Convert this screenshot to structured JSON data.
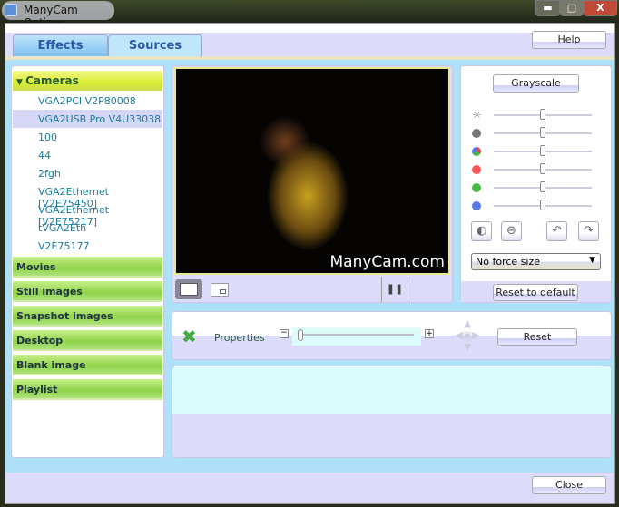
{
  "window": {
    "title": "ManyCam Options",
    "controls": [
      "minimize",
      "maximize",
      "close"
    ]
  },
  "tabs": [
    {
      "label": "Effects",
      "active": false
    },
    {
      "label": "Sources",
      "active": true
    }
  ],
  "help_label": "Help",
  "sources": {
    "cameras_label": "Cameras",
    "cameras": [
      "VGA2PCI V2P80008",
      "VGA2USB Pro V4U33038",
      "100",
      "44",
      "2fgh",
      "VGA2Ethernet [V2E75450]",
      "VGA2Ethernet [V2E75217]",
      "tVGA2Eth",
      "V2E75177"
    ],
    "selected_camera": "VGA2USB Pro V4U33038",
    "sections": [
      "Movies",
      "Still images",
      "Snapshot images",
      "Desktop",
      "Blank image",
      "Playlist"
    ]
  },
  "preview": {
    "watermark": "ManyCam.com"
  },
  "adjustments": {
    "grayscale_label": "Grayscale",
    "sliders": [
      {
        "icon": "brightness-icon",
        "value": 0.5
      },
      {
        "icon": "contrast-icon",
        "value": 0.5
      },
      {
        "icon": "saturation-icon",
        "value": 0.5
      },
      {
        "icon": "red-icon",
        "value": 0.5
      },
      {
        "icon": "green-icon",
        "value": 0.5
      },
      {
        "icon": "blue-icon",
        "value": 0.5
      }
    ],
    "force_size": "No force size",
    "reset_default_label": "Reset to default"
  },
  "properties": {
    "label": "Properties",
    "zoom_value": 0,
    "reset_label": "Reset"
  },
  "close_label": "Close"
}
